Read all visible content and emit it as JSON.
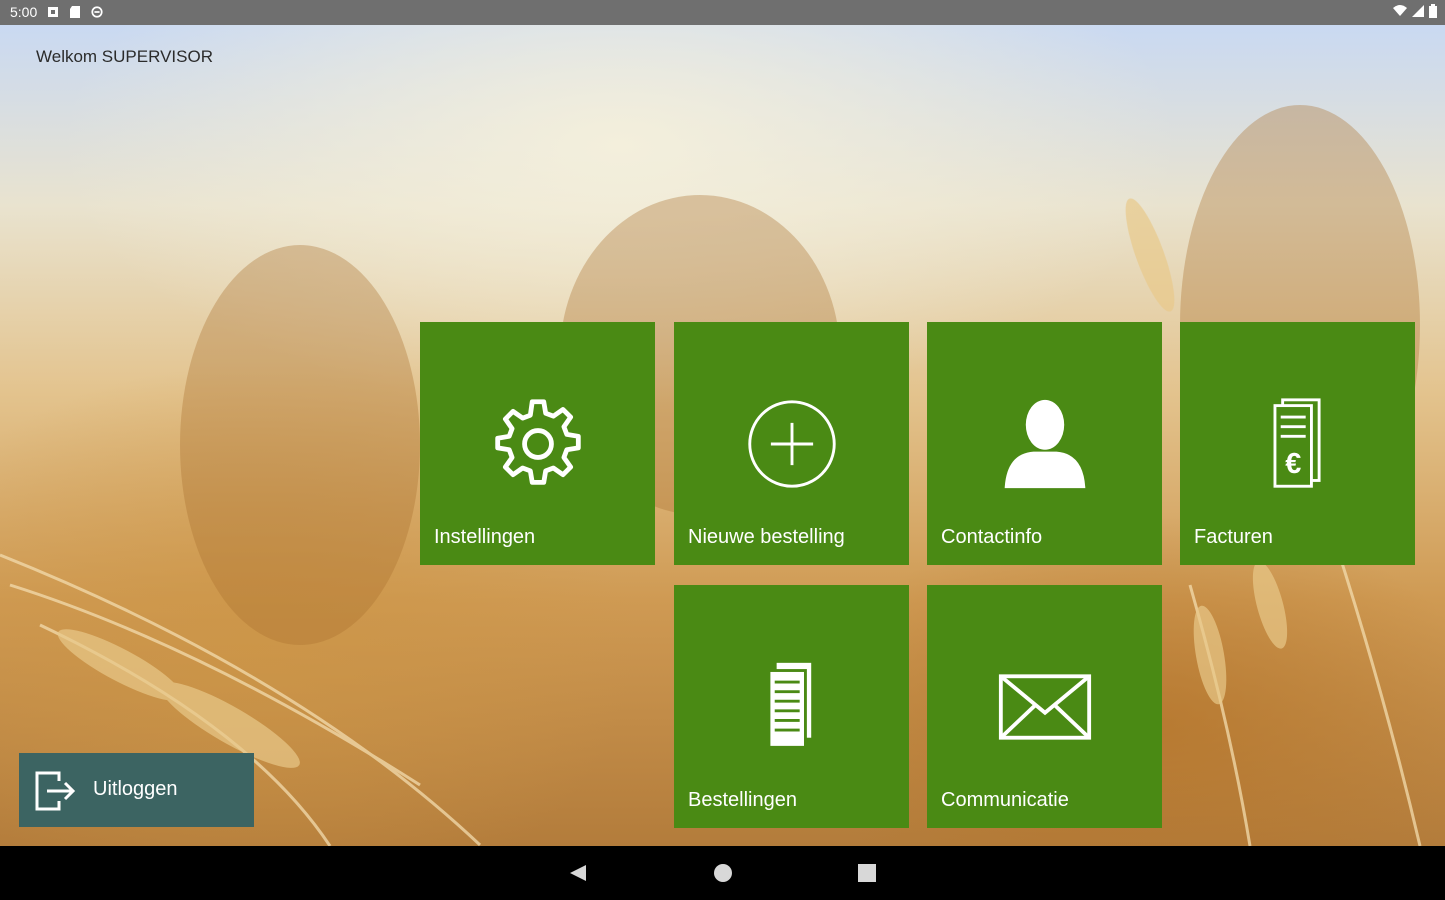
{
  "status_bar": {
    "time": "5:00"
  },
  "header": {
    "welcome": "Welkom SUPERVISOR"
  },
  "tiles": [
    {
      "label": "Instellingen",
      "icon": "gear-icon"
    },
    {
      "label": "Nieuwe bestelling",
      "icon": "plus-circle-icon"
    },
    {
      "label": "Contactinfo",
      "icon": "person-icon"
    },
    {
      "label": "Facturen",
      "icon": "euro-invoice-icon"
    },
    {
      "label": "Bestellingen",
      "icon": "documents-icon"
    },
    {
      "label": "Communicatie",
      "icon": "envelope-icon"
    }
  ],
  "logout": {
    "label": "Uitloggen",
    "icon": "logout-icon"
  },
  "colors": {
    "tile": "#4a8a14",
    "logout": "#3c6462",
    "status_bar": "#6f6f6f",
    "nav_bar": "#000000"
  }
}
